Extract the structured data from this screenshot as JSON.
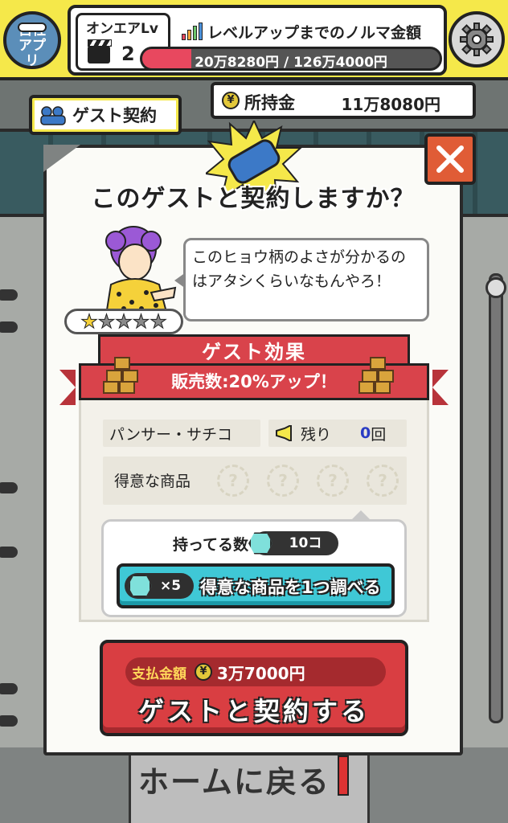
{
  "header": {
    "app_button_label": "自社アプリ",
    "onair_lv_label": "オンエアLv",
    "onair_lv_value": "2",
    "quota_label": "レベルアップまでのノルマ金額",
    "quota_progress": "20万8280円 / 126万4000円",
    "quota_fraction": 0.165,
    "settings_icon": "gear-icon"
  },
  "guest_tag": {
    "label": "ゲスト契約",
    "icon": "handshake-icon"
  },
  "money": {
    "label": "所持金",
    "value": "11万8080円",
    "icon": "yen-coin-icon"
  },
  "dialog": {
    "title": "このゲストと契約しますか？",
    "close_icon": "close-icon",
    "speech": "このヒョウ柄のよさが分かるのはアタシくらいなもんやろ！",
    "rating": {
      "filled": 1,
      "total": 5
    },
    "effect_heading": "ゲスト効果",
    "effect_text": "販売数:20%アップ！",
    "guest_name": "パンサー・サチコ",
    "remaining_label": "残り",
    "remaining_value": "0",
    "remaining_unit": "回",
    "specialty_label": "得意な商品",
    "specialty_slots": [
      "?",
      "?",
      "?",
      "?"
    ],
    "owned_label": "持ってる数",
    "owned_value": "10コ",
    "check_cost": "×5",
    "check_label": "得意な商品を1つ調べる",
    "pay_label": "支払金額",
    "pay_value": "3万7000円",
    "contract_label": "ゲストと契約する"
  },
  "background": {
    "home_label": "ホームに戻る"
  },
  "colors": {
    "header_yellow": "#f5e84a",
    "ribbon_red": "#d9434b",
    "button_cyan": "#3fc8d6",
    "button_red": "#d93e42",
    "close_orange": "#e05c36",
    "gem_teal": "#7fe0db"
  }
}
